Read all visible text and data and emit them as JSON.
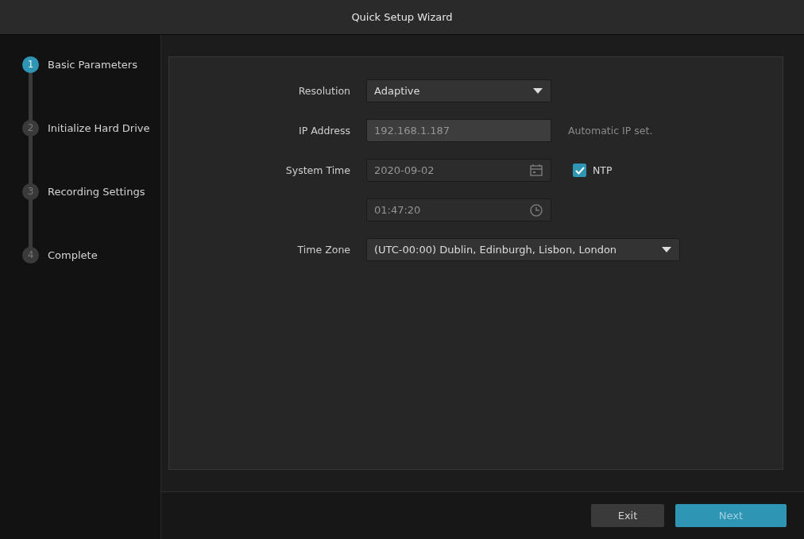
{
  "window": {
    "title": "Quick Setup Wizard"
  },
  "steps": [
    {
      "number": "1",
      "label": "Basic Parameters",
      "selected": true
    },
    {
      "number": "2",
      "label": "Initialize Hard Drive",
      "selected": false
    },
    {
      "number": "3",
      "label": "Recording Settings",
      "selected": false
    },
    {
      "number": "4",
      "label": "Complete",
      "selected": false
    }
  ],
  "form": [
    {
      "kind": "select",
      "label": "Resolution",
      "value": "Adaptive",
      "wide": false
    },
    {
      "kind": "text",
      "label": "IP Address",
      "value": "192.168.1.187",
      "disabled": true,
      "note": "Automatic IP set."
    },
    {
      "kind": "date",
      "label": "System Time",
      "value": "2020-09-02",
      "checkbox": {
        "label": "NTP",
        "checked": true
      }
    },
    {
      "kind": "time",
      "value": "01:47:20"
    },
    {
      "kind": "select",
      "label": "Time Zone",
      "value": "(UTC-00:00) Dublin, Edinburgh, Lisbon, London",
      "wide": true
    }
  ],
  "buttons": [
    {
      "label": "Exit",
      "primary": false
    },
    {
      "label": "Next",
      "primary": true
    }
  ]
}
